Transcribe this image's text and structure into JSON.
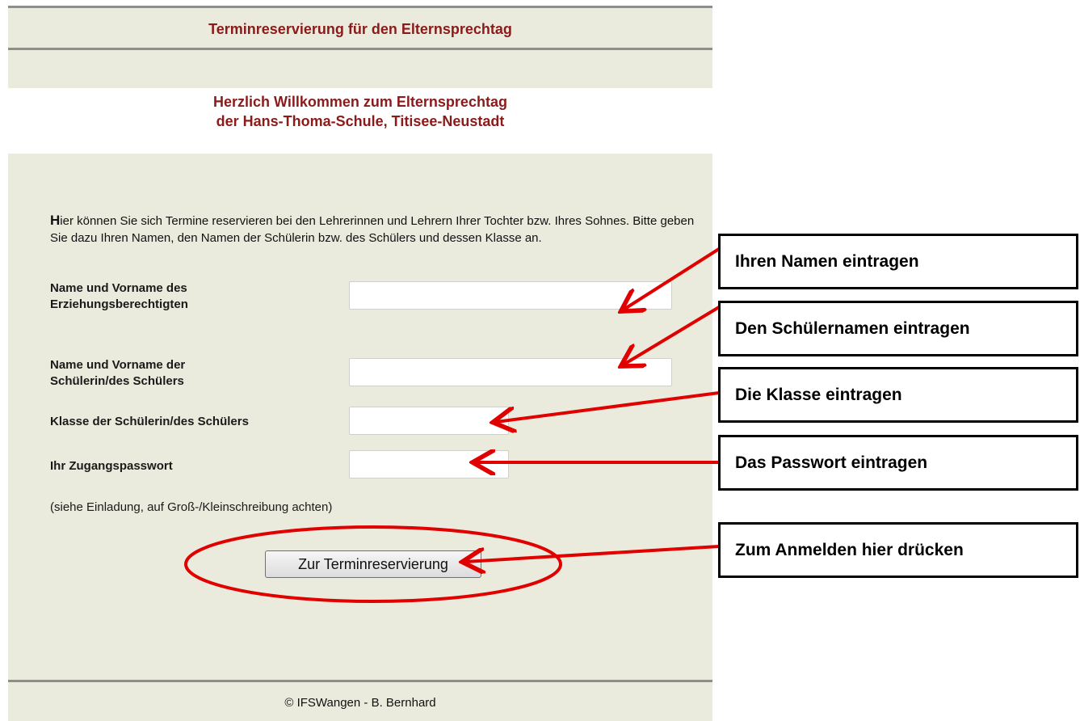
{
  "header": {
    "title": "Terminreservierung für den Elternsprechtag"
  },
  "welcome": {
    "line1": "Herzlich Willkommen zum Elternsprechtag",
    "line2": "der Hans-Thoma-Schule, Titisee-Neustadt"
  },
  "intro": {
    "first_letter": "H",
    "text": "ier können Sie sich Termine reservieren bei den Lehrerinnen und Lehrern Ihrer Tochter bzw. Ihres Sohnes. Bitte geben Sie dazu Ihren Namen, den Namen der Schülerin bzw. des Schülers und dessen Klasse an."
  },
  "form": {
    "parent_name": {
      "label_line1": "Name und Vorname des",
      "label_line2": "Erziehungsberechtigten",
      "value": ""
    },
    "student_name": {
      "label_line1": "Name und Vorname der",
      "label_line2": "Schülerin/des Schülers",
      "value": ""
    },
    "class": {
      "label": "Klasse der Schülerin/des Schülers",
      "value": ""
    },
    "password": {
      "label": "Ihr Zugangspasswort",
      "value": ""
    },
    "hint": "(siehe Einladung, auf Groß-/Kleinschreibung achten)",
    "submit_label": "Zur Terminreservierung"
  },
  "footer": {
    "text": "© IFSWangen - B. Bernhard"
  },
  "annotations": {
    "name": "Ihren Namen eintragen",
    "student": "Den Schülernamen eintragen",
    "class": "Die Klasse eintragen",
    "password": "Das Passwort eintragen",
    "submit": "Zum Anmelden hier drücken"
  },
  "colors": {
    "title": "#8b1a1a",
    "band": "#ebebdd",
    "rule": "#8e8e8e",
    "annotation_arrow": "#e00000"
  }
}
